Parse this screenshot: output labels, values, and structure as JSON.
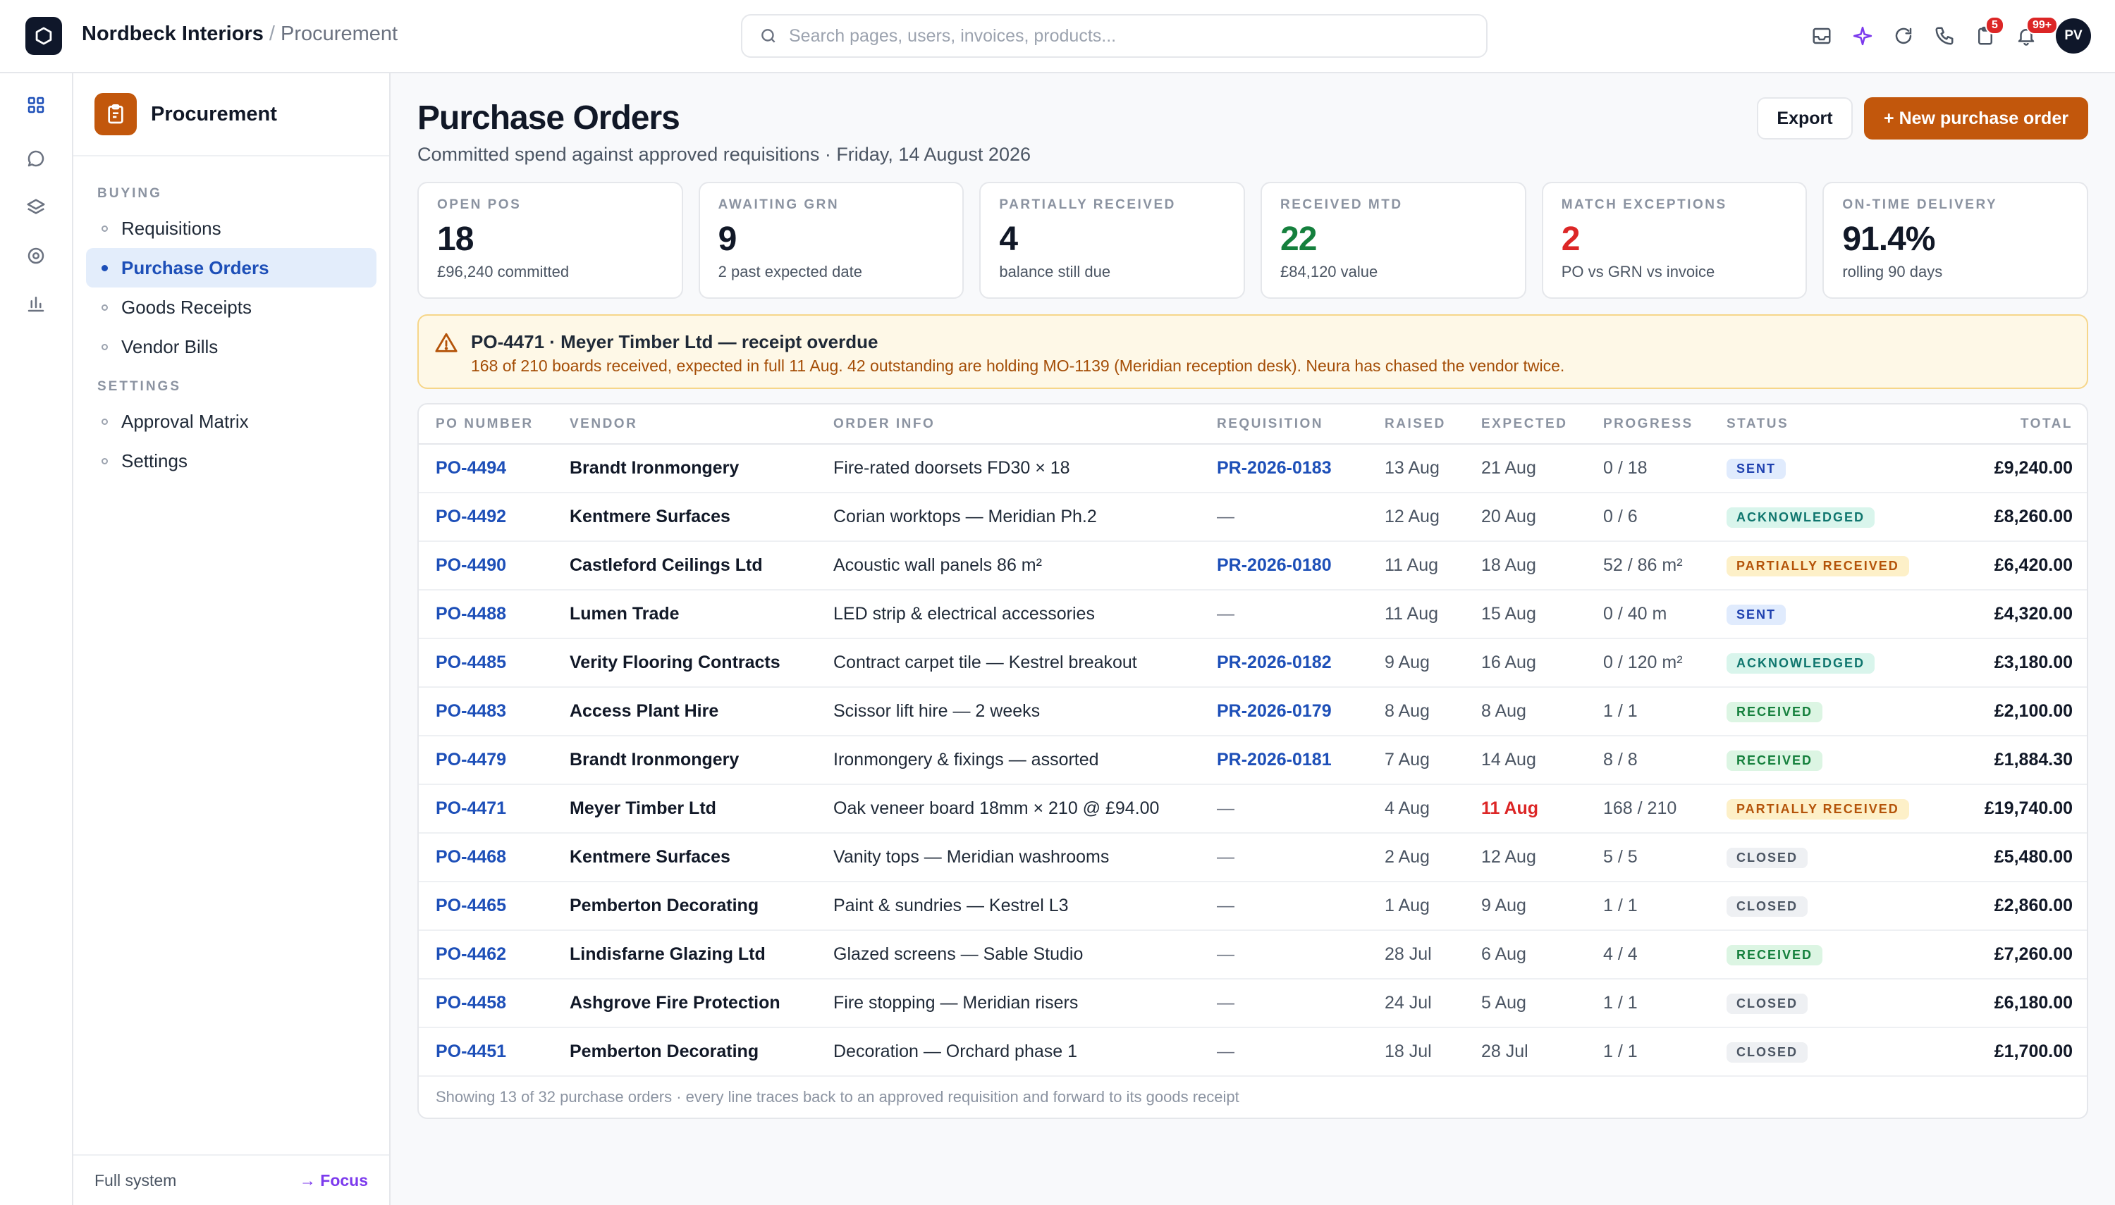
{
  "app": {
    "name": "Nordbeck Interiors",
    "separator": "/",
    "section": "Procurement"
  },
  "search": {
    "placeholder": "Search pages, users, invoices, products..."
  },
  "topbar": {
    "icons": [
      "inbox-icon",
      "sparkle-icon",
      "refresh-icon",
      "phone-icon",
      "clipboard-icon",
      "bell-icon"
    ],
    "clipboard_badge": "5",
    "bell_badge": "99+",
    "avatar_initials": "PV"
  },
  "sidebar": {
    "title": "Procurement",
    "sections": [
      {
        "label": "BUYING"
      },
      {
        "label": "SETTINGS"
      }
    ],
    "items": [
      {
        "label": "Requisitions"
      },
      {
        "label": "Purchase Orders"
      },
      {
        "label": "Goods Receipts"
      },
      {
        "label": "Vendor Bills"
      },
      {
        "label": "Approval Matrix"
      },
      {
        "label": "Settings"
      }
    ],
    "footer_mode": "Full system",
    "footer_focus": "→ Focus"
  },
  "page": {
    "title": "Purchase Orders",
    "subtitle": "Committed spend against approved requisitions · Friday, 14 August 2026",
    "export_label": "Export",
    "new_label": "+ New purchase order"
  },
  "kpis": [
    {
      "label": "OPEN POS",
      "value": "18",
      "note": "£96,240 committed",
      "color": "#111827"
    },
    {
      "label": "AWAITING GRN",
      "value": "9",
      "note": "2 past expected date",
      "color": "#111827"
    },
    {
      "label": "PARTIALLY RECEIVED",
      "value": "4",
      "note": "balance still due",
      "color": "#111827"
    },
    {
      "label": "RECEIVED MTD",
      "value": "22",
      "note": "£84,120 value",
      "color": "#15803d"
    },
    {
      "label": "MATCH EXCEPTIONS",
      "value": "2",
      "note": "PO vs GRN vs invoice",
      "color": "#dc2626"
    },
    {
      "label": "ON-TIME DELIVERY",
      "value": "91.4%",
      "note": "rolling 90 days",
      "color": "#111827"
    }
  ],
  "alert": {
    "title": "PO-4471 · Meyer Timber Ltd — receipt overdue",
    "text": "168 of 210 boards received, expected in full 11 Aug. 42 outstanding are holding MO-1139 (Meridian reception desk). Neura has chased the vendor twice."
  },
  "table": {
    "columns": [
      "PO NUMBER",
      "VENDOR",
      "ORDER INFO",
      "REQUISITION",
      "RAISED",
      "EXPECTED",
      "PROGRESS",
      "STATUS",
      "TOTAL"
    ],
    "rows": [
      {
        "po": "PO-4494",
        "vendor": "Brandt Ironmongery",
        "info": "Fire-rated doorsets FD30 × 18",
        "req": "PR-2026-0183",
        "raised": "13 Aug",
        "expected": "21 Aug",
        "progress": "0 / 18",
        "status": "SENT",
        "status_kind": "sent",
        "total": "£9,240.00",
        "overdue": false
      },
      {
        "po": "PO-4492",
        "vendor": "Kentmere Surfaces",
        "info": "Corian worktops — Meridian Ph.2",
        "req": "—",
        "raised": "12 Aug",
        "expected": "20 Aug",
        "progress": "0 / 6",
        "status": "ACKNOWLEDGED",
        "status_kind": "ack",
        "total": "£8,260.00",
        "overdue": false
      },
      {
        "po": "PO-4490",
        "vendor": "Castleford Ceilings Ltd",
        "info": "Acoustic wall panels 86 m²",
        "req": "PR-2026-0180",
        "raised": "11 Aug",
        "expected": "18 Aug",
        "progress": "52 / 86 m²",
        "status": "PARTIALLY RECEIVED",
        "status_kind": "partial",
        "total": "£6,420.00",
        "overdue": false
      },
      {
        "po": "PO-4488",
        "vendor": "Lumen Trade",
        "info": "LED strip & electrical accessories",
        "req": "—",
        "raised": "11 Aug",
        "expected": "15 Aug",
        "progress": "0 / 40 m",
        "status": "SENT",
        "status_kind": "sent",
        "total": "£4,320.00",
        "overdue": false
      },
      {
        "po": "PO-4485",
        "vendor": "Verity Flooring Contracts",
        "info": "Contract carpet tile — Kestrel breakout",
        "req": "PR-2026-0182",
        "raised": "9 Aug",
        "expected": "16 Aug",
        "progress": "0 / 120 m²",
        "status": "ACKNOWLEDGED",
        "status_kind": "ack",
        "total": "£3,180.00",
        "overdue": false
      },
      {
        "po": "PO-4483",
        "vendor": "Access Plant Hire",
        "info": "Scissor lift hire — 2 weeks",
        "req": "PR-2026-0179",
        "raised": "8 Aug",
        "expected": "8 Aug",
        "progress": "1 / 1",
        "status": "RECEIVED",
        "status_kind": "received",
        "total": "£2,100.00",
        "overdue": false
      },
      {
        "po": "PO-4479",
        "vendor": "Brandt Ironmongery",
        "info": "Ironmongery & fixings — assorted",
        "req": "PR-2026-0181",
        "raised": "7 Aug",
        "expected": "14 Aug",
        "progress": "8 / 8",
        "status": "RECEIVED",
        "status_kind": "received",
        "total": "£1,884.30",
        "overdue": false
      },
      {
        "po": "PO-4471",
        "vendor": "Meyer Timber Ltd",
        "info": "Oak veneer board 18mm × 210 @ £94.00",
        "req": "—",
        "raised": "4 Aug",
        "expected": "11 Aug",
        "progress": "168 / 210",
        "status": "PARTIALLY RECEIVED",
        "status_kind": "partial",
        "total": "£19,740.00",
        "overdue": true
      },
      {
        "po": "PO-4468",
        "vendor": "Kentmere Surfaces",
        "info": "Vanity tops — Meridian washrooms",
        "req": "—",
        "raised": "2 Aug",
        "expected": "12 Aug",
        "progress": "5 / 5",
        "status": "CLOSED",
        "status_kind": "closed",
        "total": "£5,480.00",
        "overdue": false
      },
      {
        "po": "PO-4465",
        "vendor": "Pemberton Decorating",
        "info": "Paint & sundries — Kestrel L3",
        "req": "—",
        "raised": "1 Aug",
        "expected": "9 Aug",
        "progress": "1 / 1",
        "status": "CLOSED",
        "status_kind": "closed",
        "total": "£2,860.00",
        "overdue": false
      },
      {
        "po": "PO-4462",
        "vendor": "Lindisfarne Glazing Ltd",
        "info": "Glazed screens — Sable Studio",
        "req": "—",
        "raised": "28 Jul",
        "expected": "6 Aug",
        "progress": "4 / 4",
        "status": "RECEIVED",
        "status_kind": "received",
        "total": "£7,260.00",
        "overdue": false
      },
      {
        "po": "PO-4458",
        "vendor": "Ashgrove Fire Protection",
        "info": "Fire stopping — Meridian risers",
        "req": "—",
        "raised": "24 Jul",
        "expected": "5 Aug",
        "progress": "1 / 1",
        "status": "CLOSED",
        "status_kind": "closed",
        "total": "£6,180.00",
        "overdue": false
      },
      {
        "po": "PO-4451",
        "vendor": "Pemberton Decorating",
        "info": "Decoration — Orchard phase 1",
        "req": "—",
        "raised": "18 Jul",
        "expected": "28 Jul",
        "progress": "1 / 1",
        "status": "CLOSED",
        "status_kind": "closed",
        "total": "£1,700.00",
        "overdue": false
      }
    ],
    "footer": "Showing 13 of 32 purchase orders · every line traces back to an approved requisition and forward to its goods receipt"
  }
}
